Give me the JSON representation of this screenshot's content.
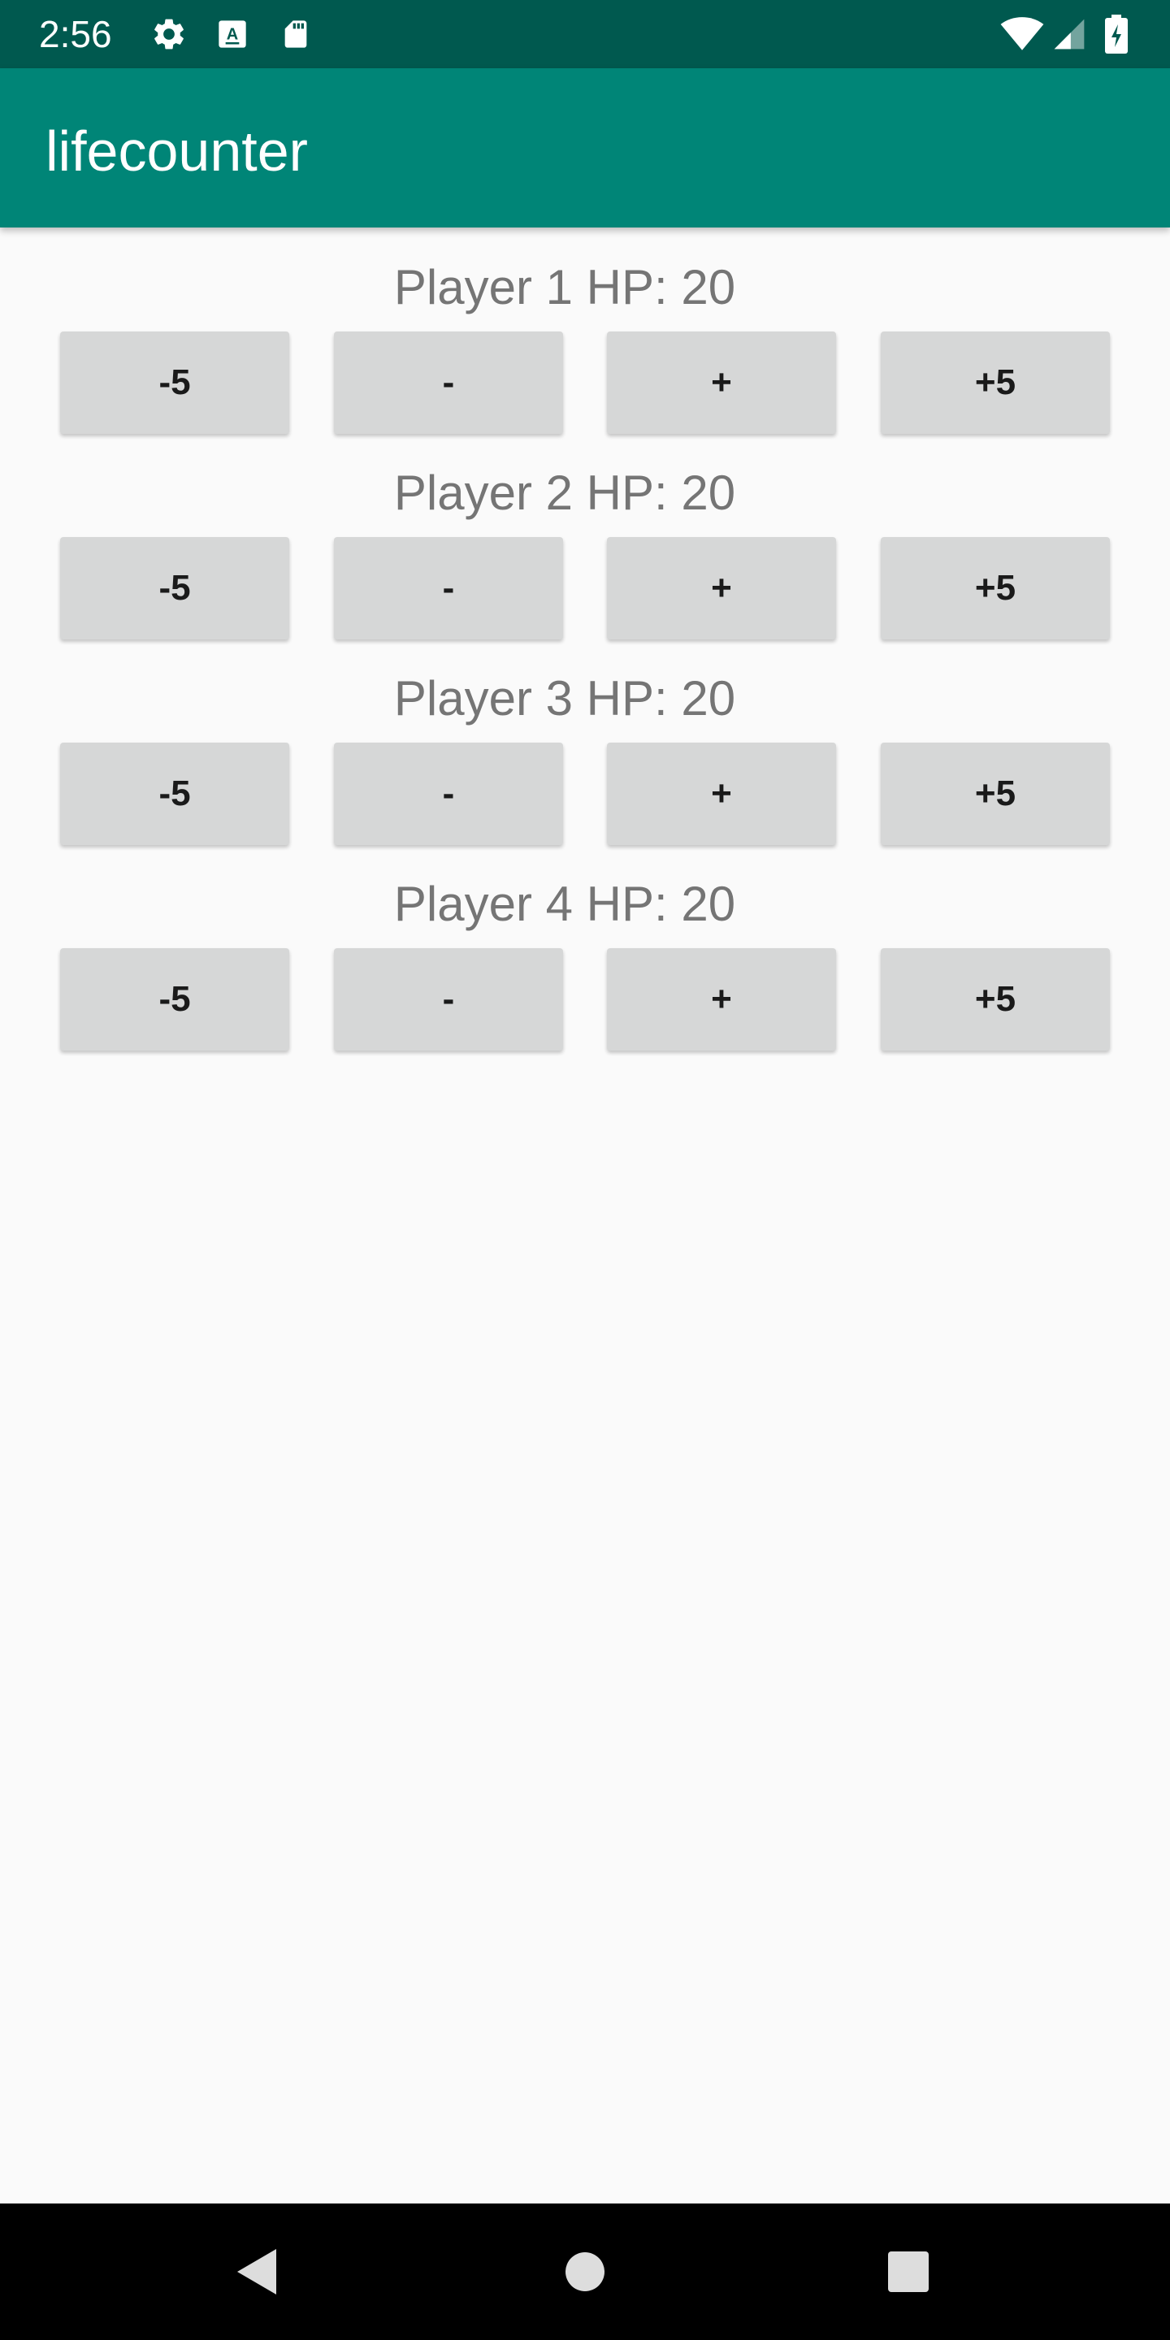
{
  "status_bar": {
    "time": "2:56",
    "icons": [
      "settings-icon",
      "text-a-icon",
      "sd-card-icon",
      "wifi-icon",
      "signal-icon",
      "battery-charging-icon"
    ]
  },
  "app_bar": {
    "title": "lifecounter"
  },
  "players": [
    {
      "label": "Player 1 HP: 20",
      "buttons": [
        "-5",
        "-",
        "+",
        "+5"
      ]
    },
    {
      "label": "Player 2 HP: 20",
      "buttons": [
        "-5",
        "-",
        "+",
        "+5"
      ]
    },
    {
      "label": "Player 3 HP: 20",
      "buttons": [
        "-5",
        "-",
        "+",
        "+5"
      ]
    },
    {
      "label": "Player 4 HP: 20",
      "buttons": [
        "-5",
        "-",
        "+",
        "+5"
      ]
    }
  ],
  "nav_bar": {
    "icons": [
      "back-icon",
      "home-icon",
      "recents-icon"
    ]
  },
  "colors": {
    "status_bar": "#00594f",
    "app_bar": "#008577",
    "background": "#fafafa",
    "button": "#d6d7d7",
    "label_text": "#757575"
  }
}
